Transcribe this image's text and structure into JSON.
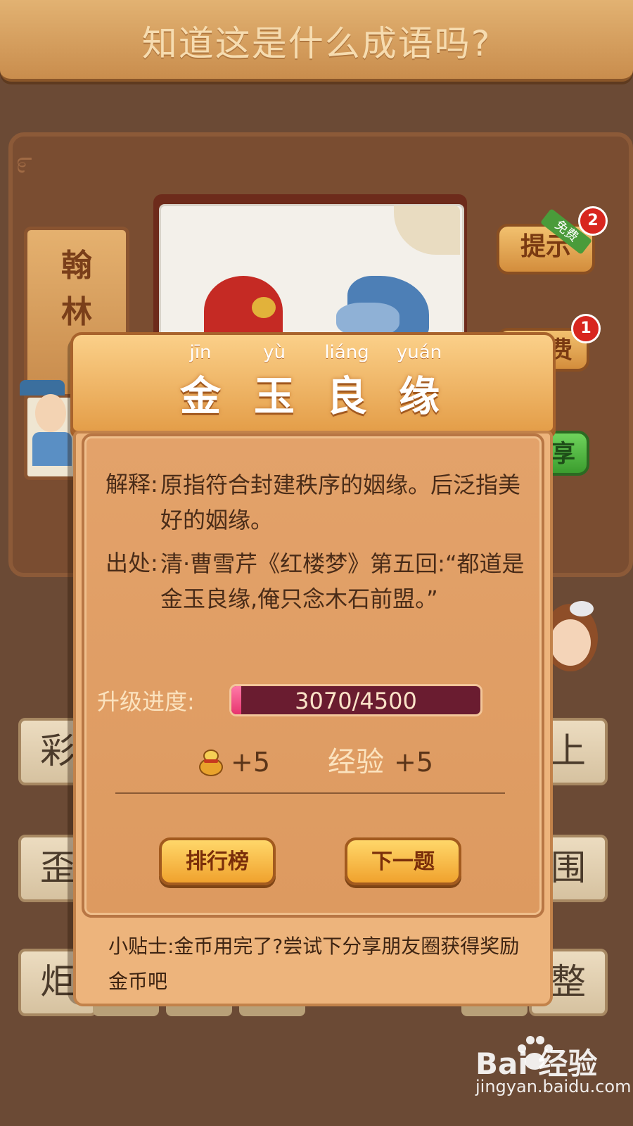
{
  "header": {
    "title": "知道这是什么成语吗?"
  },
  "board": {
    "title_plaque": "翰\n林",
    "hint_button": "提示",
    "hint_free_tag": "免费",
    "hint_badge": "2",
    "tool_button": "费",
    "tool_badge": "1",
    "share_button": "享",
    "tiles_left": [
      "彩",
      "歪",
      "炬"
    ],
    "tiles_right": [
      "上",
      "围",
      "整"
    ]
  },
  "modal": {
    "pinyin": [
      "jīn",
      "yù",
      "liáng",
      "yuán"
    ],
    "idiom": [
      "金",
      "玉",
      "良",
      "缘"
    ],
    "definition_label": "解释:",
    "definition": "原指符合封建秩序的姻缘。后泛指美好的姻缘。",
    "source_label": "出处:",
    "source": "清·曹雪芹《红楼梦》第五回:“都道是金玉良缘,俺只念木石前盟。”",
    "progress_label": "升级进度:",
    "progress_text": "3070/4500",
    "progress_fraction": 0.04,
    "coin_reward": "+5",
    "exp_label": "经验",
    "exp_reward": "+5",
    "rank_button": "排行榜",
    "next_button": "下一题",
    "tip": "小贴士:金币用完了?尝试下分享朋友圈获得奖励金币吧"
  },
  "watermark": {
    "logo": "Bai  经验",
    "url": "jingyan.baidu.com"
  }
}
